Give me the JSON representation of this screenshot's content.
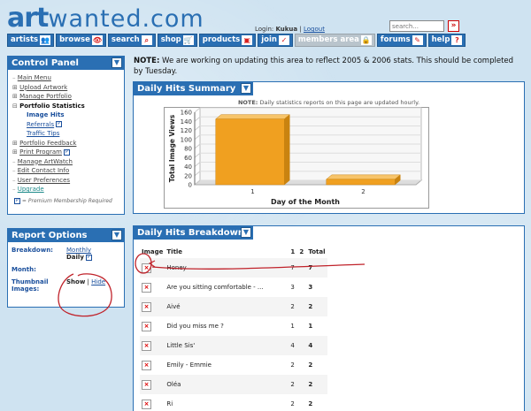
{
  "header": {
    "logo_part1": "art",
    "logo_part2": "wanted.com",
    "login_label": "Login:",
    "username": "Kukua",
    "separator": "|",
    "logout": "Logout",
    "search_placeholder": "search...",
    "search_go": "»"
  },
  "nav": [
    {
      "label": "artists",
      "icon": "people-icon",
      "glyph": "👥"
    },
    {
      "label": "browse",
      "icon": "eye-icon",
      "glyph": "👁"
    },
    {
      "label": "search",
      "icon": "magnifier-icon",
      "glyph": "⌕"
    },
    {
      "label": "shop",
      "icon": "cart-icon",
      "glyph": "🛒"
    },
    {
      "label": "products",
      "icon": "products-icon",
      "glyph": "▣"
    },
    {
      "label": "join",
      "icon": "check-icon",
      "glyph": "✓"
    },
    {
      "label": "members area",
      "icon": "lock-icon",
      "glyph": "🔒"
    },
    {
      "label": "forums",
      "icon": "chat-icon",
      "glyph": "✎"
    },
    {
      "label": "help",
      "icon": "question-icon",
      "glyph": "?"
    }
  ],
  "control_panel": {
    "title": "Control Panel",
    "items": [
      "Main Menu",
      "Upload Artwork",
      "Manage Portfolio",
      "Portfolio Statistics",
      "Image Hits",
      "Referrals",
      "Traffic Tips",
      "Portfolio Feedback",
      "Print Program",
      "Manage ArtWatch",
      "Edit Contact Info",
      "User Preferences",
      "Upgrade"
    ],
    "footnote": "= Premium Membership Required"
  },
  "report_options": {
    "title": "Report Options",
    "breakdown_label": "Breakdown:",
    "breakdown_monthly": "Monthly",
    "breakdown_daily": "Daily",
    "month_label": "Month:",
    "thumb_label": "Thumbnail Images:",
    "thumb_show": "Show",
    "thumb_sep": "|",
    "thumb_hide": "Hide"
  },
  "notice": {
    "prefix": "NOTE:",
    "text": " We are working on updating this area to reflect 2005 & 2006 stats. This should be completed by Tuesday."
  },
  "hits_summary": {
    "title": "Daily Hits Summary",
    "note_prefix": "NOTE:",
    "note_text": " Daily statistics reports on this page are updated hourly."
  },
  "chart_data": {
    "type": "bar",
    "categories": [
      "1",
      "2"
    ],
    "values": [
      145,
      12
    ],
    "xlabel": "Day of the Month",
    "ylabel": "Total Image Views",
    "ylim": [
      0,
      160
    ],
    "yticks": [
      0,
      20,
      40,
      60,
      80,
      100,
      120,
      140,
      160
    ],
    "bar_color": "#f0a020"
  },
  "hits_breakdown": {
    "title": "Daily Hits Breakdown",
    "columns": [
      "Image",
      "Title",
      "1",
      "2",
      "Total"
    ],
    "rows": [
      {
        "title": "Honey",
        "d1": "7",
        "d2": "",
        "total": "7"
      },
      {
        "title": "Are you sitting comfortable - ...",
        "d1": "3",
        "d2": "",
        "total": "3"
      },
      {
        "title": "Aivé",
        "d1": "2",
        "d2": "",
        "total": "2"
      },
      {
        "title": "Did you miss me ?",
        "d1": "1",
        "d2": "",
        "total": "1"
      },
      {
        "title": "Little Sis'",
        "d1": "4",
        "d2": "",
        "total": "4"
      },
      {
        "title": "Emily - Emmie",
        "d1": "2",
        "d2": "",
        "total": "2"
      },
      {
        "title": "Oléa",
        "d1": "2",
        "d2": "",
        "total": "2"
      },
      {
        "title": "Ri",
        "d1": "2",
        "d2": "",
        "total": "2"
      }
    ]
  },
  "colors": {
    "brand_blue": "#2a6fb3",
    "annotation_red": "#c0222a",
    "bar_orange": "#f0a020"
  }
}
